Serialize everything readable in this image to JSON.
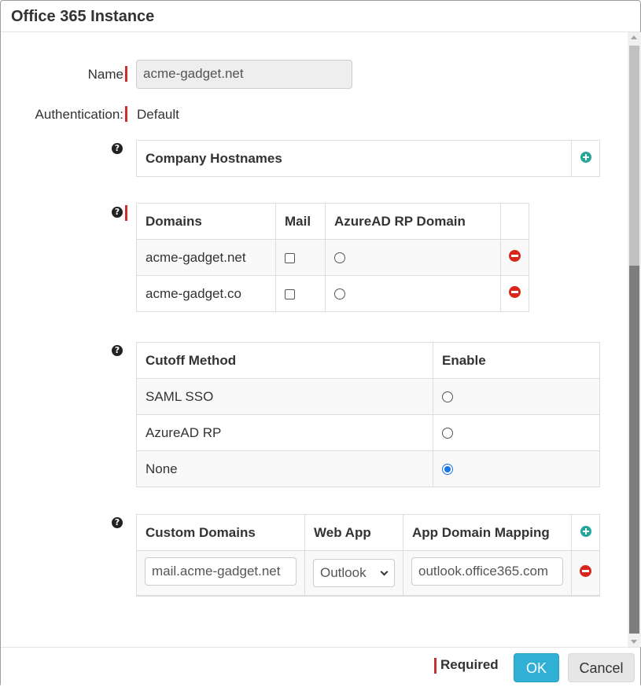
{
  "dialog": {
    "title": "Office 365 Instance"
  },
  "form": {
    "name_label": "Name",
    "name_value": "acme-gadget.net",
    "auth_label": "Authentication:",
    "auth_value": "Default"
  },
  "company_hostnames": {
    "header": "Company Hostnames"
  },
  "domains": {
    "headers": [
      "Domains",
      "Mail",
      "AzureAD RP Domain"
    ],
    "rows": [
      {
        "domain": "acme-gadget.net",
        "mail": false,
        "azuread": false
      },
      {
        "domain": "acme-gadget.co",
        "mail": false,
        "azuread": false
      }
    ]
  },
  "cutoff": {
    "headers": [
      "Cutoff Method",
      "Enable"
    ],
    "rows": [
      {
        "method": "SAML SSO",
        "enabled": false
      },
      {
        "method": "AzureAD RP",
        "enabled": false
      },
      {
        "method": "None",
        "enabled": true
      }
    ]
  },
  "custom_domains": {
    "headers": [
      "Custom Domains",
      "Web App",
      "App Domain Mapping"
    ],
    "rows": [
      {
        "domain": "mail.acme-gadget.net",
        "web_app": "Outlook",
        "mapping": "outlook.office365.com"
      }
    ]
  },
  "footer": {
    "required_label": "Required",
    "ok_label": "OK",
    "cancel_label": "Cancel"
  },
  "icons": {
    "help": "question-circle-icon",
    "add": "plus-circle-icon",
    "remove": "minus-circle-icon"
  },
  "colors": {
    "required_marker": "#c9302c",
    "add_icon": "#26a69a",
    "remove_icon": "#d9261c",
    "ok_button": "#31b0d5",
    "radio_selected": "#1a73e8"
  }
}
